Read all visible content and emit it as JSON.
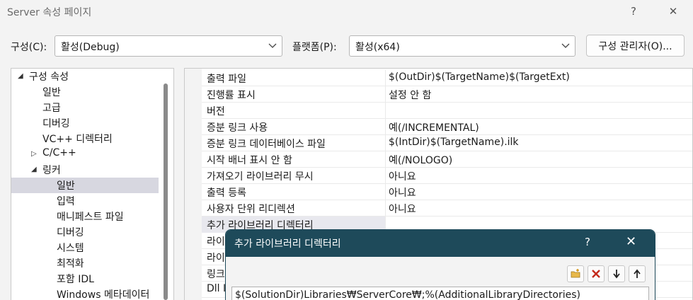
{
  "window": {
    "title": "Server 속성 페이지",
    "help_glyph": "?",
    "close_glyph": "✕"
  },
  "config": {
    "config_label": "구성(C):",
    "config_value": "활성(Debug)",
    "platform_label": "플랫폼(P):",
    "platform_value": "활성(x64)",
    "manager_button": "구성 관리자(O)..."
  },
  "tree": {
    "items": [
      {
        "label": "구성 속성",
        "indent": 0,
        "expander": "open"
      },
      {
        "label": "일반",
        "indent": 1
      },
      {
        "label": "고급",
        "indent": 1
      },
      {
        "label": "디버깅",
        "indent": 1
      },
      {
        "label": "VC++ 디렉터리",
        "indent": 1
      },
      {
        "label": "C/C++",
        "indent": 1,
        "expander": "closed"
      },
      {
        "label": "링커",
        "indent": 1,
        "expander": "open"
      },
      {
        "label": "일반",
        "indent": 2,
        "selected": true
      },
      {
        "label": "입력",
        "indent": 2
      },
      {
        "label": "매니페스트 파일",
        "indent": 2
      },
      {
        "label": "디버깅",
        "indent": 2
      },
      {
        "label": "시스템",
        "indent": 2
      },
      {
        "label": "최적화",
        "indent": 2
      },
      {
        "label": "포함 IDL",
        "indent": 2
      },
      {
        "label": "Windows 메타데이터",
        "indent": 2
      }
    ]
  },
  "properties": {
    "rows": [
      {
        "name": "출력 파일",
        "value": "$(OutDir)$(TargetName)$(TargetExt)"
      },
      {
        "name": "진행률 표시",
        "value": "설정 안 함"
      },
      {
        "name": "버전",
        "value": ""
      },
      {
        "name": "증분 링크 사용",
        "value": "예(/INCREMENTAL)"
      },
      {
        "name": "증분 링크 데이터베이스 파일",
        "value": "$(IntDir)$(TargetName).ilk"
      },
      {
        "name": "시작 배너 표시 안 함",
        "value": "예(/NOLOGO)"
      },
      {
        "name": "가져오기 라이브러리 무시",
        "value": "아니요"
      },
      {
        "name": "출력 등록",
        "value": "아니요"
      },
      {
        "name": "사용자 단위 리디렉션",
        "value": "아니요"
      },
      {
        "name": "추가 라이브러리 디렉터리",
        "value": "",
        "selected": true
      },
      {
        "name": "라이",
        "value": ""
      },
      {
        "name": "라이",
        "value": ""
      },
      {
        "name": "링크",
        "value": ""
      },
      {
        "name": "Dll I",
        "value": ""
      }
    ]
  },
  "dialog": {
    "title": "추가 라이브러리 디렉터리",
    "help_glyph": "?",
    "close_glyph": "✕",
    "input_value": "$(SolutionDir)Libraries₩ServerCore₩;%(AdditionalLibraryDirectories)",
    "tools": [
      "new-folder-icon",
      "delete-icon",
      "move-down-icon",
      "move-up-icon"
    ]
  },
  "colors": {
    "dialog_title_bg": "#1e4a5a",
    "selection_bg": "#d7d7e0",
    "delete_red": "#c42b1c"
  }
}
